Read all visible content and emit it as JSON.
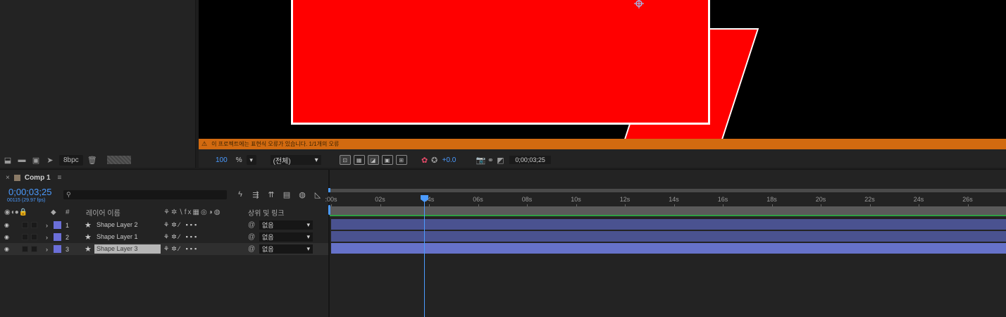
{
  "project": {
    "bpc": "8bpc",
    "footer_icons": [
      "interpret-footage-icon",
      "new-folder-icon",
      "new-composition-icon",
      "flowchart-icon"
    ],
    "trash_icon": "trash-icon"
  },
  "viewer": {
    "warning_text": "이 프로젝트에는 표현식 오류가 있습니다. 1/1개의 오류",
    "zoom_value": "100",
    "zoom_unit": "%",
    "resolution": "(전체)",
    "exposure": "+0.0",
    "current_time": "0;00;03;25",
    "colors": {
      "shape_fill": "#ff0000",
      "shape_stroke": "#ffffff",
      "warning": "#d26a10",
      "accent": "#4b9bff"
    }
  },
  "timeline": {
    "tab_label": "Comp 1",
    "current_time": "0;00;03;25",
    "fps_line": "00115 (29.97 fps)",
    "search_glyph": "⚲",
    "header": {
      "layer_name": "레이어 이름",
      "hash": "#",
      "parent": "상위 및 링크"
    },
    "ruler_labels": [
      ":00s",
      "02s",
      "04s",
      "06s",
      "08s",
      "10s",
      "12s",
      "14s",
      "16s",
      "18s",
      "20s",
      "22s",
      "24s",
      "26s"
    ],
    "layers": [
      {
        "num": "1",
        "name": "Shape Layer 2",
        "parent": "없음",
        "selected": false
      },
      {
        "num": "2",
        "name": "Shape Layer 1",
        "parent": "없음",
        "selected": false
      },
      {
        "num": "3",
        "name": "Shape Layer 3",
        "parent": "없음",
        "selected": true
      }
    ]
  }
}
